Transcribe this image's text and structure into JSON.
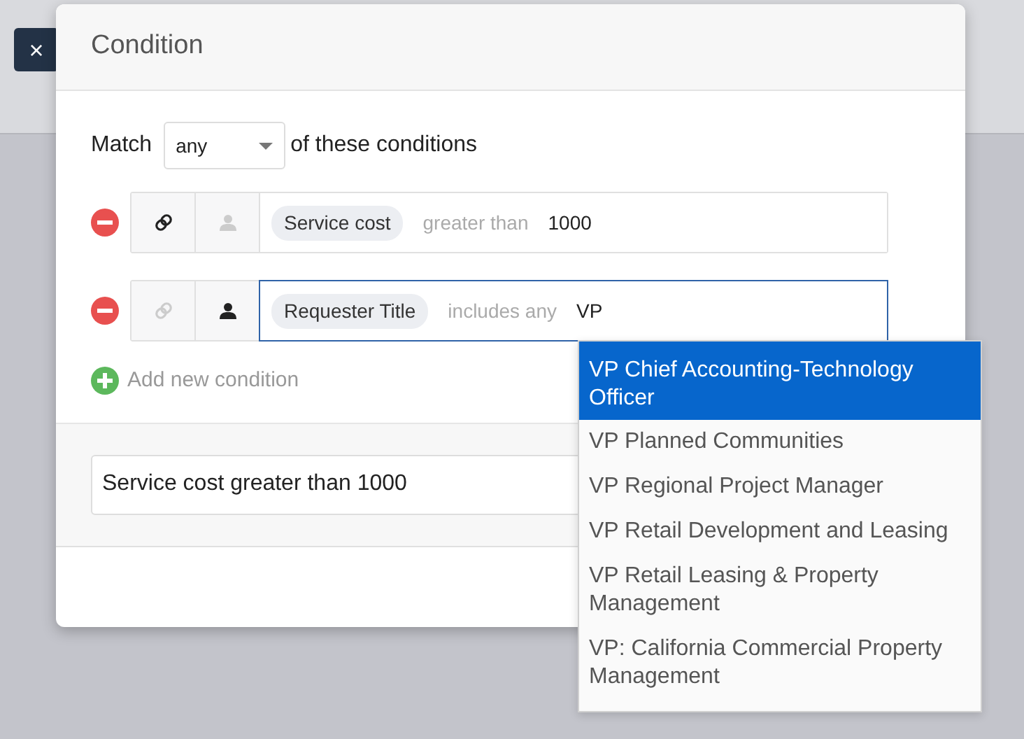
{
  "close_button": {
    "label": "×"
  },
  "dialog": {
    "title": "Condition",
    "match": {
      "prefix": "Match",
      "value": "any",
      "suffix": "of these conditions"
    },
    "conditions": [
      {
        "item_scope": true,
        "requester_scope": false,
        "focused": false,
        "field": "Service cost",
        "operator": "greater than",
        "value": "1000"
      },
      {
        "item_scope": false,
        "requester_scope": true,
        "focused": true,
        "field": "Requester Title",
        "operator": "includes any",
        "value": "VP"
      }
    ],
    "add_label": "Add new condition",
    "summary": "Service cost greater than 1000"
  },
  "suggestions": [
    {
      "label": "VP Chief Accounting-Technology Officer",
      "selected": true
    },
    {
      "label": "VP Planned Communities",
      "selected": false
    },
    {
      "label": "VP Regional Project Manager",
      "selected": false
    },
    {
      "label": "VP Retail Development and Leasing",
      "selected": false
    },
    {
      "label": "VP Retail Leasing & Property Management",
      "selected": false
    },
    {
      "label": "VP: California Commercial Property Management",
      "selected": false
    }
  ]
}
